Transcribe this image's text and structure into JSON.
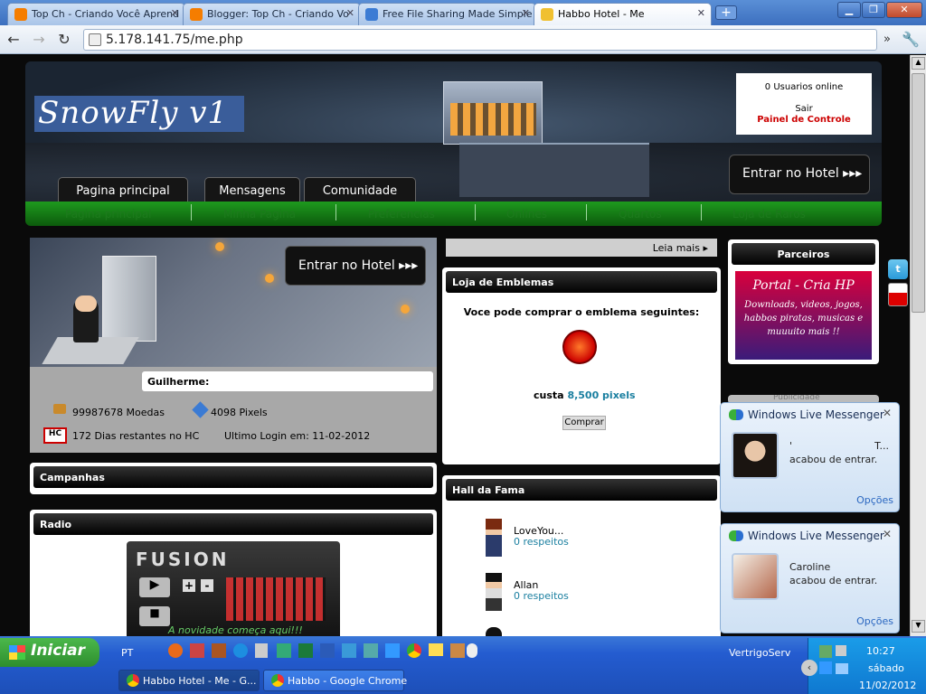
{
  "browser": {
    "tabs": [
      {
        "title": "Top Ch - Criando Você Aprend",
        "favicon": "blogger-icon",
        "color": "#f57d00"
      },
      {
        "title": "Blogger: Top Ch - Criando Vo",
        "favicon": "blogger-icon",
        "color": "#f57d00"
      },
      {
        "title": "Free File Sharing Made Simple",
        "favicon": "mediafire-icon",
        "color": "#3b7bd4"
      },
      {
        "title": "Habbo Hotel - Me",
        "favicon": "habbo-icon",
        "color": "#f0c030"
      }
    ],
    "new_tab": "+",
    "url": "5.178.141.75/me.php"
  },
  "site": {
    "logo": "SnowFly v1",
    "online": "0 Usuarios online",
    "sair": "Sair",
    "painel": "Painel de Controle",
    "enter_hotel": "Entrar no Hotel ▸▸▸",
    "top_tabs": [
      "Pagina principal",
      "Mensagens",
      "Comunidade"
    ],
    "subnav": [
      "Pagina principal",
      "Minha Pagina",
      "Preferencias",
      "Onlines",
      "Quartos",
      "Loja de Raros"
    ],
    "profile": {
      "enter_hotel": "Entrar no Hotel ▸▸▸",
      "name": "Guilherme:",
      "moedas": "99987678 Moedas",
      "pixels": "4098 Pixels",
      "hc_badge": "HC",
      "hc": "172 Dias restantes no HC",
      "login": "Ultimo Login em: 11-02-2012"
    },
    "campanhas": "Campanhas",
    "radio": "Radio",
    "radio_player": {
      "title": "FUSION",
      "plus": "+",
      "minus": "-",
      "slogan": "A novidade começa aqui!!!"
    },
    "leia_mais": "Leia mais ▸",
    "loja": {
      "title": "Loja de Emblemas",
      "text": "Voce pode comprar o emblema seguintes:",
      "custa": "custa",
      "price": "8,500 pixels",
      "buy": "Comprar"
    },
    "hall": {
      "title": "Hall da Fama",
      "entries": [
        {
          "name": "LoveYou...",
          "resp": "0 respeitos"
        },
        {
          "name": "Allan",
          "resp": "0 respeitos"
        }
      ]
    },
    "parceiros": {
      "title": "Parceiros",
      "banner_title": "Portal - Cria HP",
      "banner_text": "Downloads, videos, jogos, habbos piratas, musicas e muuuito mais !!"
    },
    "publicidade": "Publicidade",
    "social": [
      "twitter-icon",
      "youtube-icon"
    ]
  },
  "msn": [
    {
      "title": "Windows Live Messenger",
      "name": "'",
      "name_right": "T...",
      "status": "acabou de entrar.",
      "options": "Opções"
    },
    {
      "title": "Windows Live Messenger",
      "name": "Caroline",
      "status": "acabou de entrar.",
      "options": "Opções"
    }
  ],
  "taskbar": {
    "start": "Iniciar",
    "lang": "PT",
    "tasks": [
      "Habbo Hotel - Me - G...",
      "Habbo - Google Chrome"
    ],
    "vertrigo": "VertrigoServ",
    "time": "10:27",
    "day": "sábado",
    "date": "11/02/2012"
  }
}
